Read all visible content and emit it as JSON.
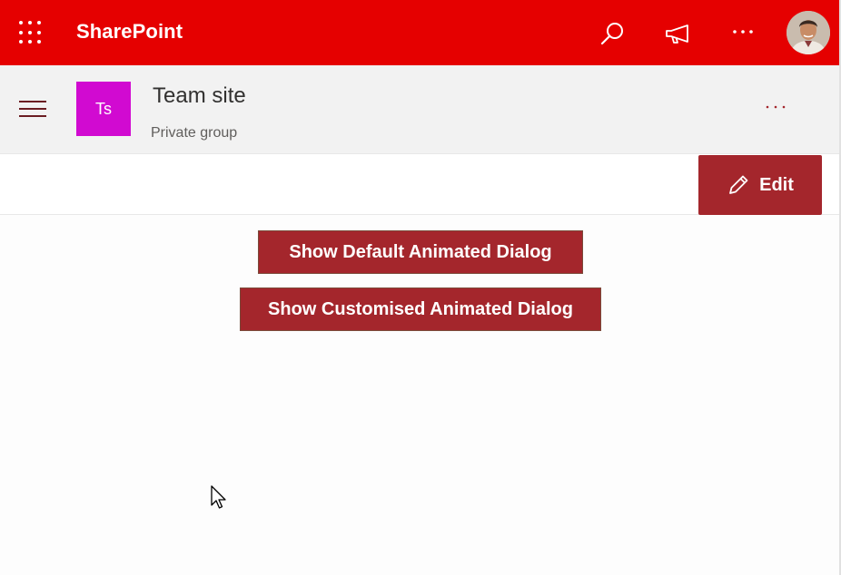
{
  "suite_bar": {
    "brand": "SharePoint",
    "background": "#e50000",
    "icons": [
      "app-launcher-icon",
      "search-icon",
      "megaphone-icon",
      "more-icon"
    ]
  },
  "site_header": {
    "logo_initials": "Ts",
    "logo_color": "#d10ad1",
    "title": "Team site",
    "subtitle": "Private group"
  },
  "command_bar": {
    "edit_label": "Edit",
    "accent": "#a4262c"
  },
  "actions": {
    "default_dialog_label": "Show Default Animated Dialog",
    "custom_dialog_label": "Show Customised Animated Dialog"
  }
}
